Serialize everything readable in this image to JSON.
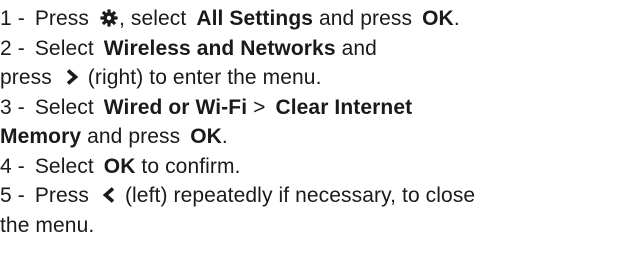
{
  "steps": [
    {
      "number": "1 -",
      "t1": "Press",
      "t2": ", select",
      "b1": "All Settings",
      "t3": "and press",
      "b2": "OK",
      "t4": "."
    },
    {
      "number": "2 -",
      "t1": "Select",
      "b1": "Wireless and Networks",
      "t2": "and",
      "t3": "press",
      "t4": "(right) to enter the menu."
    },
    {
      "number": "3 -",
      "t1": "Select",
      "b1": "Wired or Wi-Fi",
      "t2": ">",
      "b2": "Clear Internet",
      "b3": "Memory",
      "t3": "and press",
      "b4": "OK",
      "t4": "."
    },
    {
      "number": "4 -",
      "t1": "Select",
      "b1": "OK",
      "t2": "to confirm."
    },
    {
      "number": "5 -",
      "t1": "Press",
      "t2": "(left) repeatedly if necessary, to close",
      "t3": "the menu."
    }
  ],
  "icons": {
    "settings": "gear-icon",
    "right": "chevron-right-icon",
    "left": "chevron-left-icon"
  }
}
